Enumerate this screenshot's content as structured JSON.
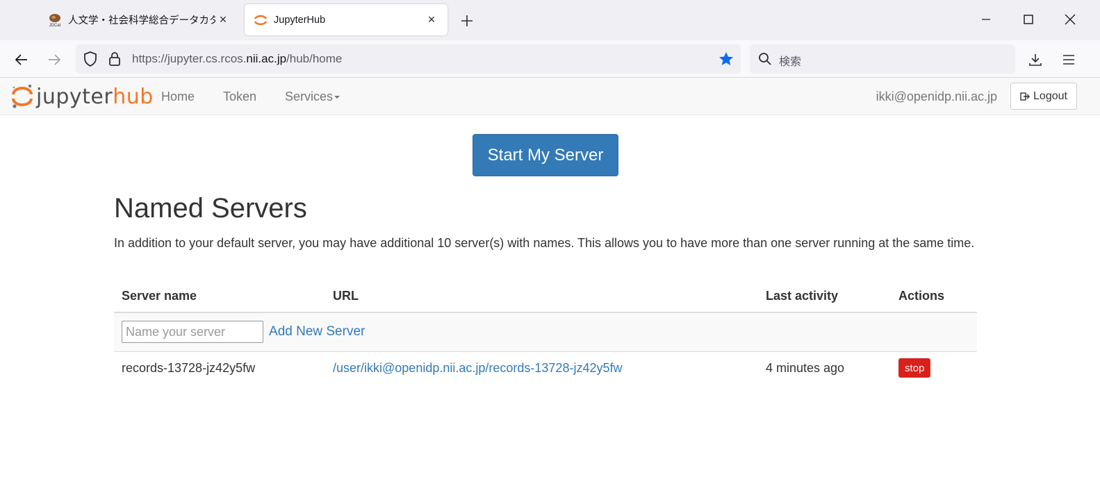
{
  "browser": {
    "tabs": [
      {
        "title": "人文学・社会科学総合データカタ",
        "favicon_label": "JDCat",
        "active": false
      },
      {
        "title": "JupyterHub",
        "active": true
      }
    ],
    "url": {
      "prefix": "https://jupyter.cs.rcos.",
      "domain": "nii.ac.jp",
      "path": "/hub/home"
    },
    "search_placeholder": "検索",
    "bookmark_color": "#0a6bf2"
  },
  "hub_nav": {
    "logo_word1": "jupyter",
    "logo_word2": "hub",
    "links": [
      "Home",
      "Token",
      "Services"
    ],
    "user": "ikki@openidp.nii.ac.jp",
    "logout_label": "Logout"
  },
  "main": {
    "start_button": "Start My Server",
    "title": "Named Servers",
    "intro": "In addition to your default server, you may have additional 10 server(s) with names. This allows you to have more than one server running at the same time.",
    "table": {
      "headers": [
        "Server name",
        "URL",
        "Last activity",
        "Actions"
      ],
      "name_placeholder": "Name your server",
      "add_label": "Add New Server",
      "rows": [
        {
          "name": "records-13728-jz42y5fw",
          "url": "/user/ikki@openidp.nii.ac.jp/records-13728-jz42y5fw",
          "last_activity": "4 minutes ago",
          "action": "stop"
        }
      ]
    }
  },
  "colors": {
    "primary": "#337ab7",
    "danger": "#d9201b",
    "jupyter_orange": "#f37726"
  }
}
